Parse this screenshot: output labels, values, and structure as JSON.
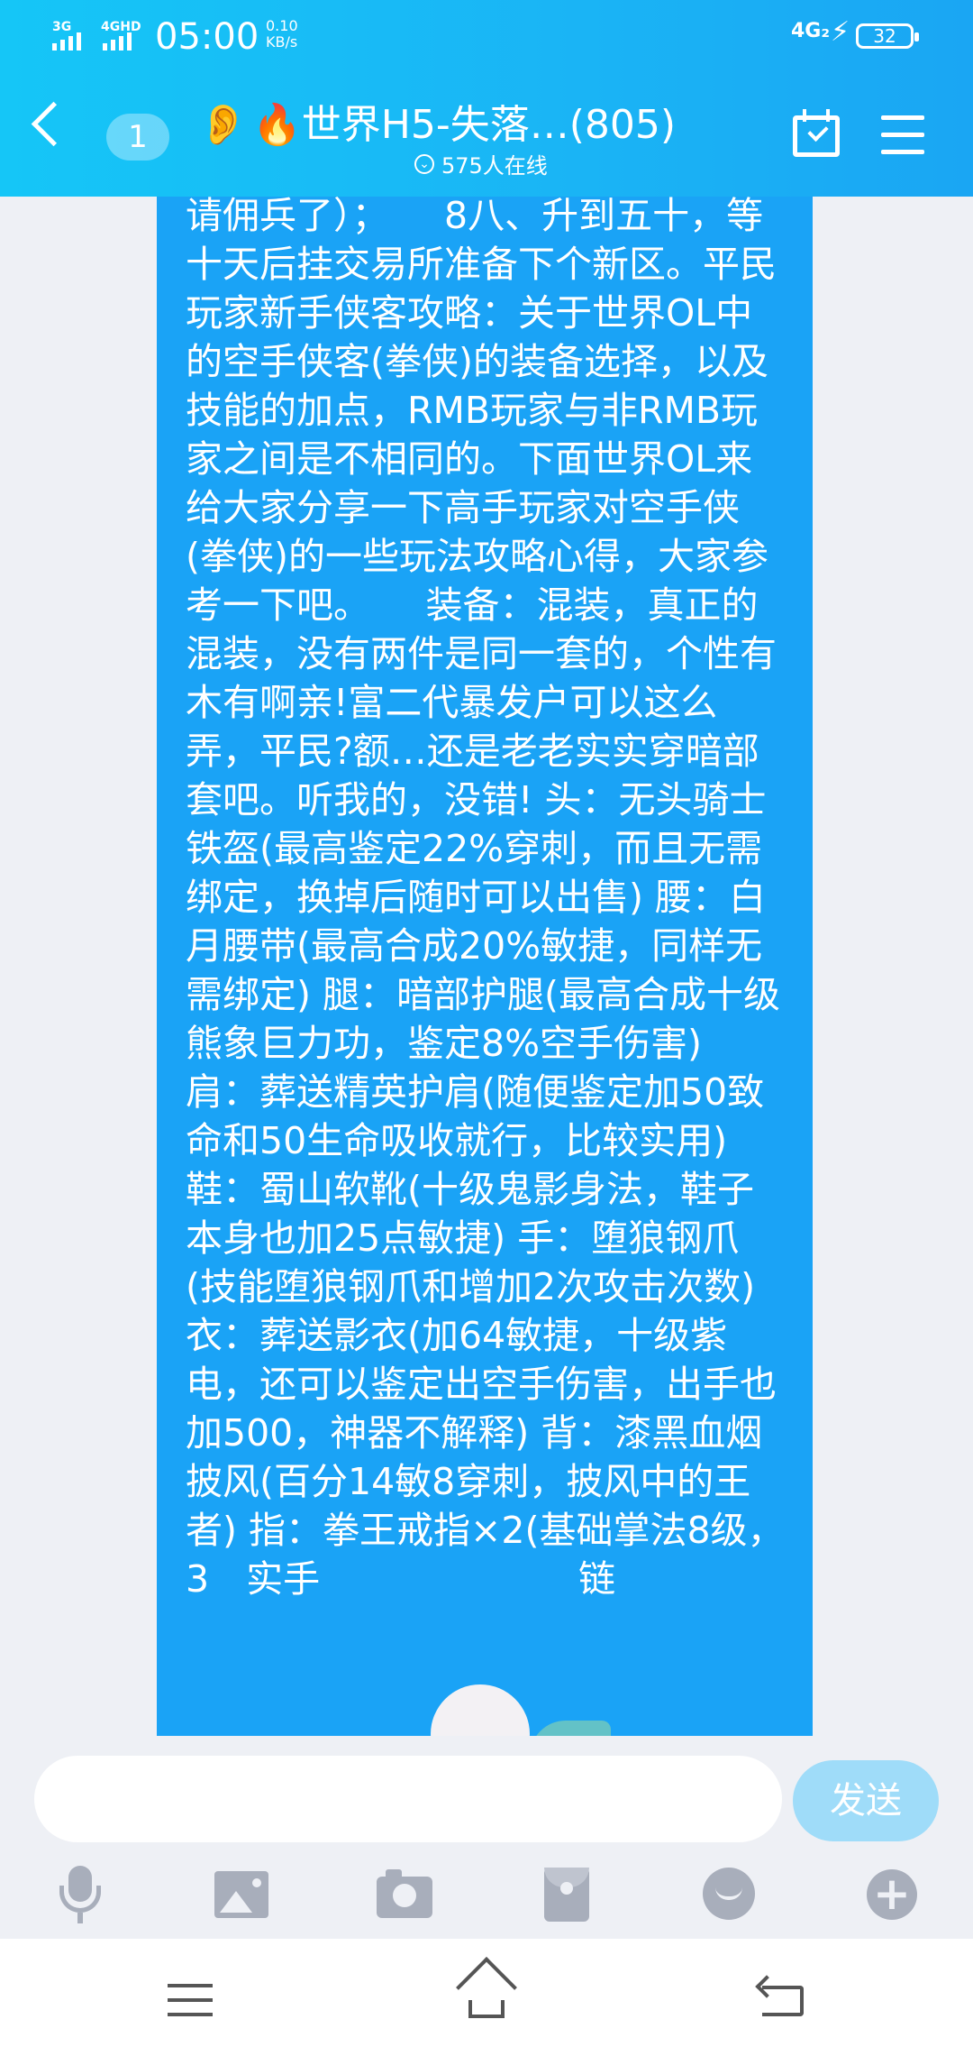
{
  "status_bar": {
    "net1": "3G",
    "net2": "4GHD",
    "time": "05:00",
    "speed_value": "0.10",
    "speed_unit": "KB/s",
    "network": "4G₂",
    "battery": "32"
  },
  "header": {
    "unread": "1",
    "title": "🔥世界H5-失落…(805)",
    "online": "575人在线"
  },
  "message": {
    "text": "物理经验和一个血瓶奖励（这些够你请佣兵了）；　　8八、升到五十，等十天后挂交易所准备下个新区。平民玩家新手侠客攻略：关于世界OL中的空手侠客(拳侠)的装备选择，以及技能的加点，RMB玩家与非RMB玩家之间是不相同的。下面世界OL来给大家分享一下高手玩家对空手侠(拳侠)的一些玩法攻略心得，大家参考一下吧。　　装备：混装，真正的混装，没有两件是同一套的，个性有木有啊亲!富二代暴发户可以这么弄，平民?额…还是老老实实穿暗部套吧。听我的，没错! 头：无头骑士铁盔(最高鉴定22%穿刺，而且无需绑定，换掉后随时可以出售) 腰：白月腰带(最高合成20%敏捷，同样无需绑定) 腿：暗部护腿(最高合成十级熊象巨力功，鉴定8%空手伤害) 肩：葬送精英护肩(随便鉴定加50致命和50生命吸收就行，比较实用) 鞋：蜀山软靴(十级鬼影身法，鞋子本身也加25点敏捷) 手：堕狼钢爪(技能堕狼钢爪和增加2次攻击次数) 衣：葬送影衣(加64敏捷，十级紫电，还可以鉴定出空手伤害，出手也加500，神器不解释) 背：漆黑血烟披风(百分14敏8穿刺，披风中的王者) 指：拳王戒指×2(基础掌法8级，3　实手　　　　　　　链"
  },
  "input": {
    "placeholder": "",
    "send_label": "发送"
  },
  "toolbar": {
    "items": [
      "mic-icon",
      "image-icon",
      "camera-icon",
      "red-packet-icon",
      "emoji-icon",
      "plus-icon"
    ]
  },
  "colors": {
    "header": "#1ab4f5",
    "bubble": "#1aa3f6",
    "send_button": "#9fdcf9"
  }
}
